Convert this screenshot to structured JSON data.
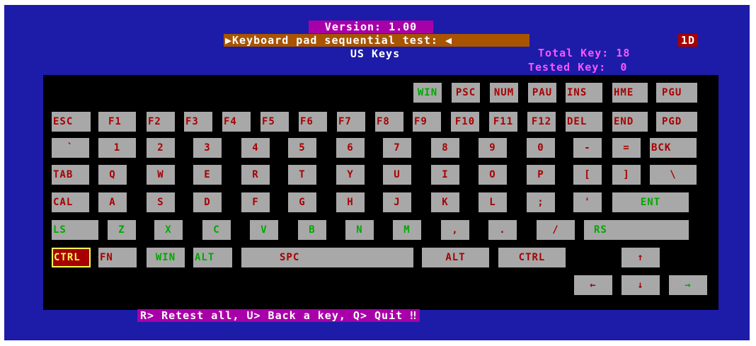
{
  "header": {
    "version": "Version: 1.00",
    "title": "▶Keyboard pad sequential test: ◀",
    "layout": "US Keys",
    "code": "1D",
    "total_key": "Total Key: 18",
    "tested_key": "Tested Key:  0"
  },
  "keys": {
    "win_top": "WIN",
    "psc": "PSC",
    "num": "NUM",
    "pau": "PAU",
    "ins": "INS",
    "hme": "HME",
    "pgu": "PGU",
    "esc": "ESC",
    "f1": "F1",
    "f2": "F2",
    "f3": "F3",
    "f4": "F4",
    "f5": "F5",
    "f6": "F6",
    "f7": "F7",
    "f8": "F8",
    "f9": "F9",
    "f10": "F10",
    "f11": "F11",
    "f12": "F12",
    "del": "DEL",
    "end": "END",
    "pgd": "PGD",
    "backtick": "`",
    "n1": "1",
    "n2": "2",
    "n3": "3",
    "n4": "4",
    "n5": "5",
    "n6": "6",
    "n7": "7",
    "n8": "8",
    "n9": "9",
    "n0": "0",
    "minus": "-",
    "equals": "=",
    "bck": "BCK",
    "tab": "TAB",
    "q": "Q",
    "w": "W",
    "e": "E",
    "r": "R",
    "t": "T",
    "y": "Y",
    "u": "U",
    "i": "I",
    "o": "O",
    "p": "P",
    "lbracket": "[",
    "rbracket": "]",
    "backslash": "\\",
    "cal": "CAL",
    "a": "A",
    "s": "S",
    "d": "D",
    "f": "F",
    "g": "G",
    "h": "H",
    "j": "J",
    "k": "K",
    "l": "L",
    "semicolon": ";",
    "quote": "'",
    "ent": "ENT",
    "ls": "LS",
    "z": "Z",
    "x": "X",
    "c": "C",
    "v": "V",
    "b": "B",
    "n": "N",
    "m": "M",
    "comma": ",",
    "period": ".",
    "slash": "/",
    "rs": "RS",
    "ctrl_left": "CTRL",
    "fn": "FN",
    "win_bottom": "WIN",
    "alt_left": "ALT",
    "spc": "SPC",
    "alt_right": "ALT",
    "ctrl_right": "CTRL",
    "up": "↑",
    "left": "←",
    "down": "↓",
    "right": "→"
  },
  "footer": "R> Retest all, U> Back a key, Q> Quit ‼",
  "colors": {
    "background": "#1c1ca8",
    "pad": "#000000",
    "key": "#a8a8a8",
    "untested_text": "#a80000",
    "tested_text": "#00a800",
    "current_key": "#a80000",
    "current_key_text": "#ffff55"
  }
}
